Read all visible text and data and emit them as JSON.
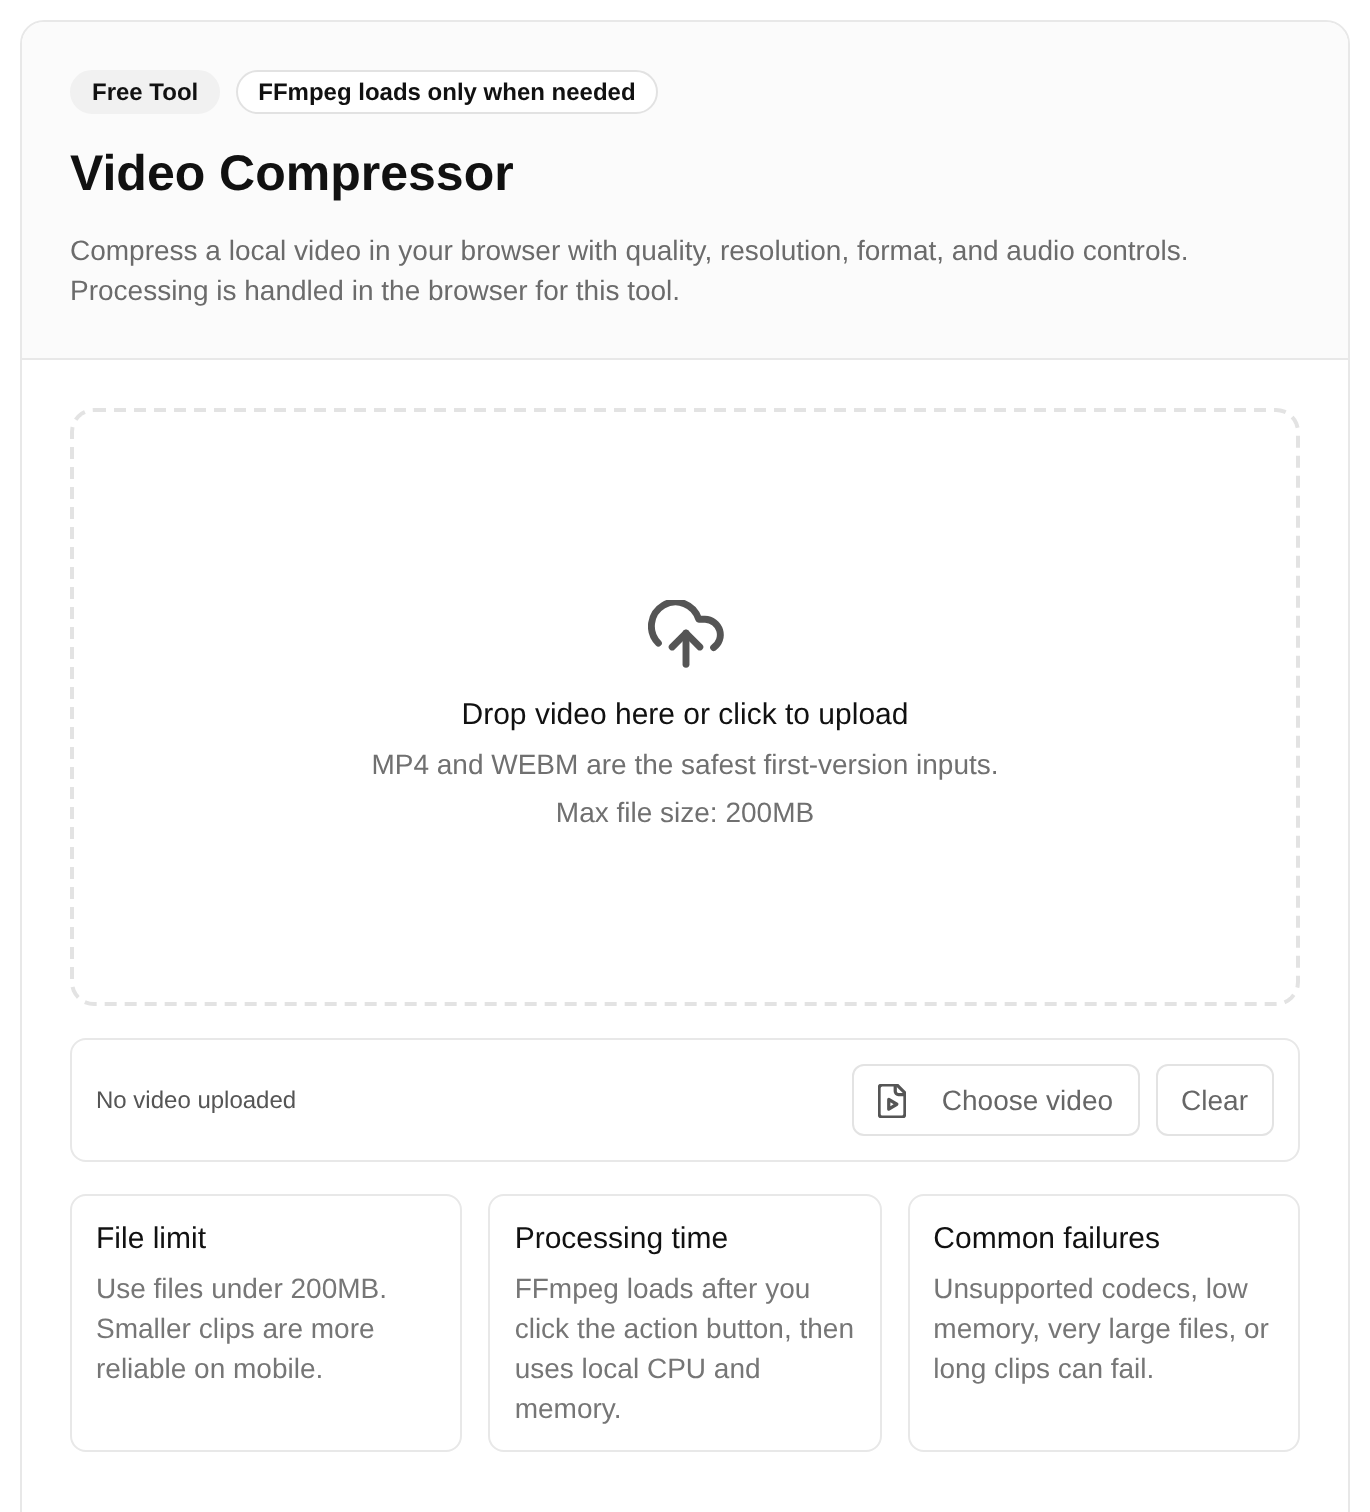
{
  "header": {
    "badges": [
      {
        "label": "Free Tool",
        "kind": "filled"
      },
      {
        "label": "FFmpeg loads only when needed",
        "kind": "outline"
      }
    ],
    "title": "Video Compressor",
    "description": "Compress a local video in your browser with quality, resolution, format, and audio controls. Processing is handled in the browser for this tool."
  },
  "dropzone": {
    "heading": "Drop video here or click to upload",
    "lines": [
      "MP4 and WEBM are the safest first-version inputs.",
      "Max file size: 200MB"
    ]
  },
  "file_bar": {
    "status": "No video uploaded",
    "buttons": [
      {
        "label": "Choose video",
        "kind": "file"
      },
      {
        "label": "Clear",
        "kind": "plain"
      }
    ]
  },
  "info_cards": [
    {
      "title": "File limit",
      "text": "Use files under 200MB. Smaller clips are more reliable on mobile."
    },
    {
      "title": "Processing time",
      "text": "FFmpeg loads after you click the action button, then uses local CPU and memory."
    },
    {
      "title": "Common failures",
      "text": "Unsupported codecs, low memory, very large files, or long clips can fail."
    }
  ]
}
